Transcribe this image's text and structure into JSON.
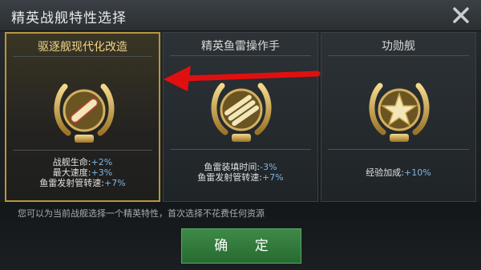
{
  "dialog": {
    "title": "精英战舰特性选择",
    "note": "您可以为当前战舰选择一个精英特性，首次选择不花费任何资源",
    "confirm_label": "确 定"
  },
  "cards": [
    {
      "name": "驱逐舰现代化改造",
      "selected": true,
      "icon": "torpedo-laurel-emblem",
      "stats": [
        {
          "label": "战舰生命:",
          "value": "+2%"
        },
        {
          "label": "最大速度:",
          "value": "+3%"
        },
        {
          "label": "鱼雷发射管转速:",
          "value": "+7%"
        }
      ]
    },
    {
      "name": "精英鱼雷操作手",
      "selected": false,
      "icon": "torpedo-tubes-laurel-emblem",
      "stats": [
        {
          "label": "鱼雷装填时间:",
          "value": "-3%"
        },
        {
          "label": "鱼雷发射管转速:",
          "value": "+7%"
        }
      ]
    },
    {
      "name": "功勋舰",
      "selected": false,
      "icon": "star-laurel-emblem",
      "stats": [
        {
          "label": "经验加成:",
          "value": "+10%"
        }
      ]
    }
  ],
  "colors": {
    "gold": "#b9953e",
    "stat_value": "#7fb6e6",
    "confirm_green": "#2f7a38",
    "arrow_red": "#e01010"
  }
}
